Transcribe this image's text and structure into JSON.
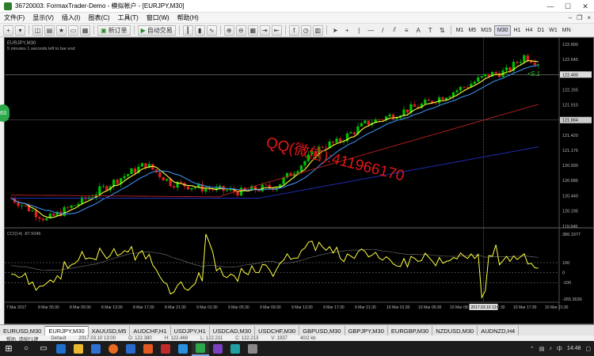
{
  "window": {
    "title": "36720003: FormaxTrader-Demo - 模拟帐户 - [EURJPY,M30]",
    "btn_minimize": "—",
    "btn_maximize": "☐",
    "btn_close": "✕"
  },
  "menu": {
    "items": [
      "文件(F)",
      "显示(V)",
      "插入(I)",
      "图表(C)",
      "工具(T)",
      "窗口(W)",
      "帮助(H)"
    ],
    "mdi_minimize": "–",
    "mdi_restore": "❐",
    "mdi_close": "×"
  },
  "toolbar": {
    "new_order": "新订单",
    "auto_trading": "自动交易",
    "timeframes": [
      "M1",
      "M5",
      "M15",
      "M30",
      "H1",
      "H4",
      "D1",
      "W1",
      "MN"
    ],
    "active_timeframe": "M30"
  },
  "chart": {
    "symbol_label": "EURJPY,M30",
    "countdown": "5 minutes 1 seconds left to bar end",
    "price_labels": [
      "122.890",
      "122.645",
      "122.400",
      "122.155",
      "121.910",
      "121.664",
      "121.420",
      "121.175",
      "120.930",
      "120.685",
      "120.440",
      "120.195",
      "119.945"
    ],
    "bid_price": "122.400",
    "line_price": "121.664",
    "ratio_label": "<5:1",
    "indicator_label": "CCI(14) -87.5046",
    "cci_labels": [
      "386.1977",
      "100",
      "0",
      "-100",
      "-265.3636"
    ],
    "time_labels": [
      "7 Mar 2017",
      "8 Mar 05:30",
      "8 Mar 09:30",
      "8 Mar 13:30",
      "8 Mar 17:30",
      "8 Mar 21:30",
      "9 Mar 01:30",
      "9 Mar 05:30",
      "9 Mar 09:30",
      "9 Mar 13:30",
      "9 Mar 17:30",
      "9 Mar 21:30",
      "10 Mar 01:30",
      "10 Mar 05:30",
      "10 Mar 09:30",
      "10 Mar 13:30",
      "10 Mar 17:30",
      "10 Mar 21:30"
    ],
    "cursor_time": "2017.03.10 13:00",
    "badge": "63",
    "watermark": "QQ(微信):411966170",
    "colors": {
      "bull": "#00c000",
      "bear": "#e02020",
      "ma_fast": "#ffff40",
      "ma_mid": "#3a8ee8",
      "ma_slow_red": "#c02020",
      "ma_slow_blue": "#2030c0",
      "cci": "#ffff40"
    }
  },
  "symbol_tabs": [
    "EURUSD,M30",
    "EURJPY,M30",
    "XAUUSD,M5",
    "AUDCHF,H1",
    "USDJPY,H1",
    "USDCAD,M30",
    "USDCHF,M30",
    "GBPUSD,M30",
    "GBPJPY,M30",
    "EURGBP,M30",
    "NZDUSD,M30",
    "AUDNZD,H4"
  ],
  "active_symbol_tab": "EURJPY,M30",
  "status": {
    "help": "帮助, 请按F1键",
    "profile": "Default",
    "datetime": "2017.03.10 13:00",
    "open": "O: 122.380",
    "high": "H: 122.469",
    "low": "L: 122.211",
    "close": "C: 122.213",
    "volume": "V: 1937",
    "traffic": "40/2 kb"
  },
  "taskbar": {
    "clock": "14:48",
    "ime": "中",
    "apps": [
      "start",
      "search",
      "task-view",
      "edge",
      "explorer",
      "store",
      "firefox",
      "mail",
      "app-orange",
      "app-red",
      "app-blue",
      "app-green",
      "app-purple",
      "app-teal",
      "app-gray"
    ]
  }
}
